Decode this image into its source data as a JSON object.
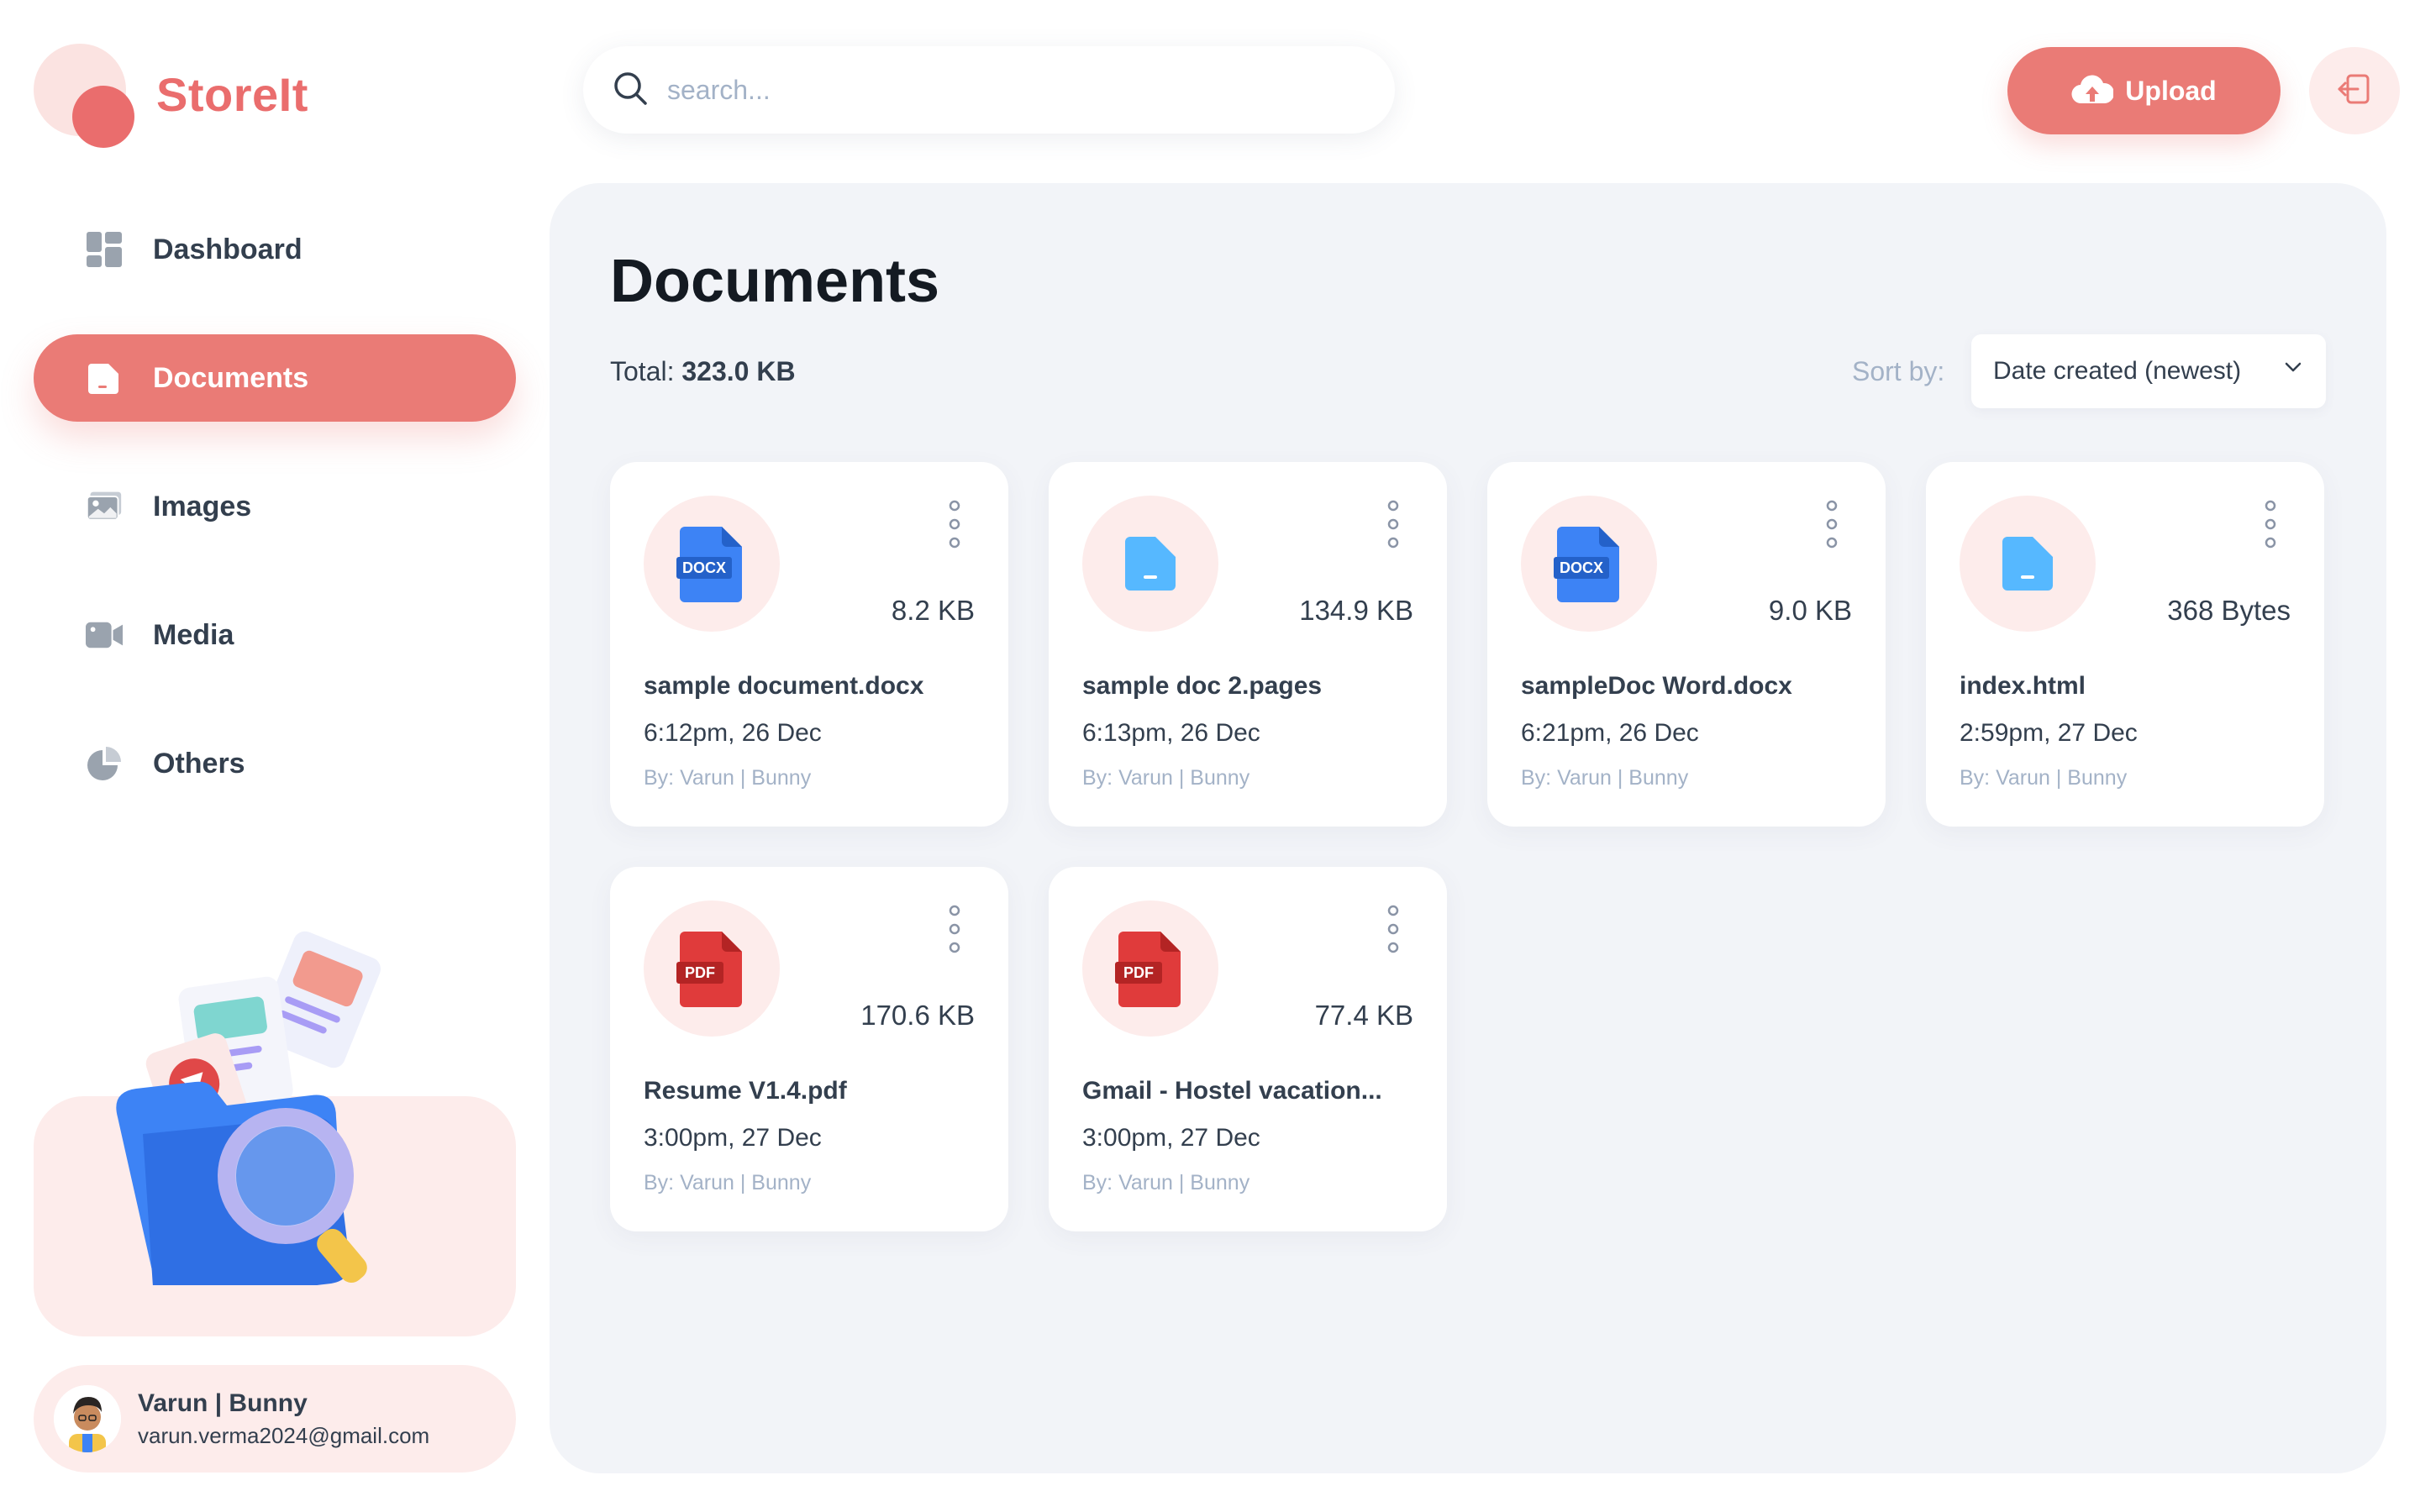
{
  "app": {
    "name": "StoreIt"
  },
  "sidebar": {
    "items": [
      {
        "label": "Dashboard",
        "icon": "dashboard-icon",
        "active": false
      },
      {
        "label": "Documents",
        "icon": "documents-icon",
        "active": true
      },
      {
        "label": "Images",
        "icon": "images-icon",
        "active": false
      },
      {
        "label": "Media",
        "icon": "media-icon",
        "active": false
      },
      {
        "label": "Others",
        "icon": "others-icon",
        "active": false
      }
    ]
  },
  "user": {
    "name": "Varun | Bunny",
    "email": "varun.verma2024@gmail.com"
  },
  "header": {
    "search_placeholder": "search...",
    "upload_label": "Upload"
  },
  "page": {
    "title": "Documents",
    "total_label": "Total:",
    "total_value": "323.0 KB",
    "sort_label": "Sort by:",
    "sort_value": "Date created (newest)"
  },
  "files": [
    {
      "name": "sample document.docx",
      "size": "8.2 KB",
      "date": "6:12pm, 26 Dec",
      "owner": "By: Varun | Bunny",
      "type": "DOCX"
    },
    {
      "name": "sample doc 2.pages",
      "size": "134.9 KB",
      "date": "6:13pm, 26 Dec",
      "owner": "By: Varun | Bunny",
      "type": "DOC"
    },
    {
      "name": "sampleDoc Word.docx",
      "size": "9.0 KB",
      "date": "6:21pm, 26 Dec",
      "owner": "By: Varun | Bunny",
      "type": "DOCX"
    },
    {
      "name": "index.html",
      "size": "368 Bytes",
      "date": "2:59pm, 27 Dec",
      "owner": "By: Varun | Bunny",
      "type": "DOC"
    },
    {
      "name": "Resume V1.4.pdf",
      "size": "170.6 KB",
      "date": "3:00pm, 27 Dec",
      "owner": "By: Varun | Bunny",
      "type": "PDF"
    },
    {
      "name": "Gmail - Hostel vacation...",
      "size": "77.4 KB",
      "date": "3:00pm, 27 Dec",
      "owner": "By: Varun | Bunny",
      "type": "PDF"
    }
  ],
  "colors": {
    "brand": "#ea6d6d",
    "brand_light": "#fdeceb",
    "panel": "#f2f4f8",
    "text": "#333f4e",
    "muted": "#a3b2c7",
    "docx_blue": "#2f6fe4",
    "folder_blue": "#56b8ff",
    "pdf_red": "#d8302f"
  }
}
